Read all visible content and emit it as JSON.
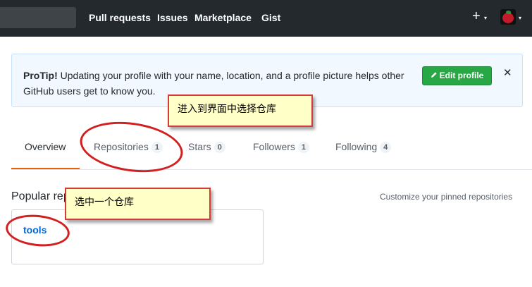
{
  "topnav": {
    "items": [
      "Pull requests",
      "Issues",
      "Marketplace",
      "Gist"
    ],
    "plus_icon": "+",
    "caret_icon": "▾"
  },
  "protip": {
    "label": "ProTip!",
    "text": " Updating your profile with your name, location, and a profile picture helps other GitHub users get to know you.",
    "edit_button": "Edit profile",
    "close_icon": "✕"
  },
  "tabs": [
    {
      "label": "Overview",
      "count": null
    },
    {
      "label": "Repositories",
      "count": "1"
    },
    {
      "label": "Stars",
      "count": "0"
    },
    {
      "label": "Followers",
      "count": "1"
    },
    {
      "label": "Following",
      "count": "4"
    }
  ],
  "popular": {
    "heading": "Popular rep",
    "customize_link": "Customize your pinned repositories",
    "repo_name": "tools"
  },
  "annotations": {
    "select_repo_section": "进入到界面中选择仓库",
    "select_one_repo": "选中一个仓库"
  },
  "colors": {
    "header_bg": "#24292e",
    "accent_orange": "#e36209",
    "link_blue": "#0366d6",
    "button_green": "#28a745",
    "annotation_red": "#d21f1f"
  }
}
